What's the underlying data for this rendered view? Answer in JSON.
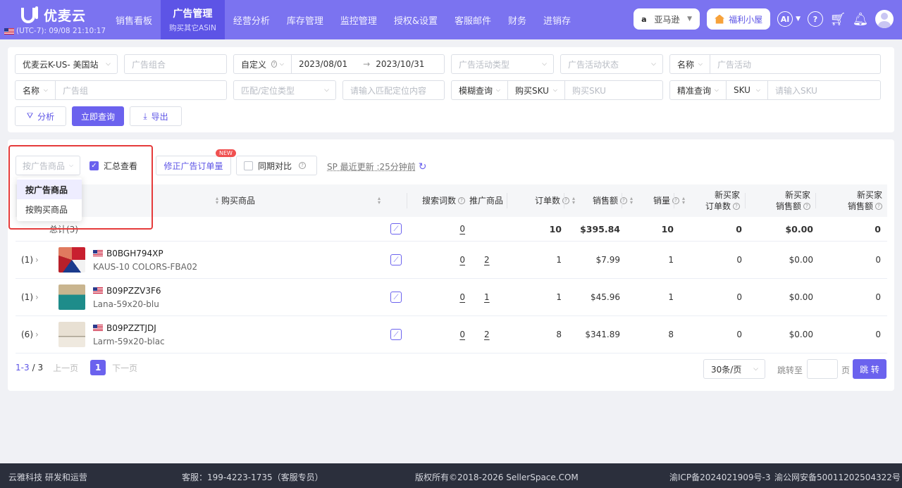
{
  "header": {
    "brand": "优麦云",
    "timezone": "(UTC-7): 09/08 21:10:17",
    "nav": [
      {
        "label": "销售看板",
        "sub": ""
      },
      {
        "label": "广告管理",
        "sub": "购买其它ASIN"
      },
      {
        "label": "经营分析",
        "sub": ""
      },
      {
        "label": "库存管理",
        "sub": ""
      },
      {
        "label": "监控管理",
        "sub": ""
      },
      {
        "label": "授权&设置",
        "sub": ""
      },
      {
        "label": "客服邮件",
        "sub": ""
      },
      {
        "label": "财务",
        "sub": ""
      },
      {
        "label": "进销存",
        "sub": ""
      }
    ],
    "marketplace": "亚马逊",
    "welfare": "福利小屋",
    "ai_label": "AI"
  },
  "filters": {
    "store": "优麦云K-US- 美国站",
    "ad_group_combo_ph": "广告组合",
    "date_mode": "自定义",
    "date_start": "2023/08/01",
    "date_arrow": "→",
    "date_end": "2023/10/31",
    "campaign_type_ph": "广告活动类型",
    "campaign_status_ph": "广告活动状态",
    "name_label_1": "名称",
    "campaign_ph": "广告活动",
    "name_label_2": "名称",
    "ad_group_ph": "广告组",
    "match_type_ph": "匹配/定位类型",
    "match_content_ph": "请输入匹配定位内容",
    "fuzzy_label": "模糊查询",
    "buy_sku_label": "购买SKU",
    "buy_sku_ph": "购买SKU",
    "exact_label": "精准查询",
    "sku_label": "SKU",
    "sku_ph": "请输入SKU",
    "analyze_btn": "分析",
    "query_btn": "立即查询",
    "export_btn": "导出"
  },
  "toolbar": {
    "group_by_ph": "按广告商品",
    "summary_label": "汇总查看",
    "fix_orders_label": "修正广告订单量",
    "new_tag": "NEW",
    "compare_label": "同期对比",
    "updated_label": "SP 最近更新 :25分钟前",
    "dropdown": [
      "按广告商品",
      "按购买商品"
    ]
  },
  "table": {
    "headers": {
      "buy_product": "购买商品",
      "search_terms": "搜索词数",
      "ad_product": "推广商品",
      "orders": "订单数",
      "sales": "销售额",
      "units": "销量",
      "nb_orders_1": "新买家",
      "nb_orders_2": "订单数",
      "nb_sales_1": "新买家",
      "nb_sales_2": "销售额",
      "nb_sales_b_1": "新买家",
      "nb_sales_b_2": "销售额"
    },
    "total": {
      "label": "总计(3)",
      "search_terms": "0",
      "orders": "10",
      "sales": "$395.84",
      "units": "10",
      "nb_orders": "0",
      "nb_sales": "$0.00",
      "nb_sales_b": "0"
    },
    "rows": [
      {
        "count": "(1)",
        "asin": "B0BGH794XP",
        "sku": "KAUS-10 COLORS-FBA02",
        "search_terms": "0",
        "ad_product": "2",
        "orders": "1",
        "sales": "$7.99",
        "units": "1",
        "nb_orders": "0",
        "nb_sales": "$0.00",
        "nb_sales_b": "0"
      },
      {
        "count": "(1)",
        "asin": "B09PZZV3F6",
        "sku": "Lana-59x20-blu",
        "search_terms": "0",
        "ad_product": "1",
        "orders": "1",
        "sales": "$45.96",
        "units": "1",
        "nb_orders": "0",
        "nb_sales": "$0.00",
        "nb_sales_b": "0"
      },
      {
        "count": "(6)",
        "asin": "B09PZZTJDJ",
        "sku": "Larm-59x20-blac",
        "search_terms": "0",
        "ad_product": "2",
        "orders": "8",
        "sales": "$341.89",
        "units": "8",
        "nb_orders": "0",
        "nb_sales": "$0.00",
        "nb_sales_b": "0"
      }
    ]
  },
  "pager": {
    "range": "1-3",
    "total": "/ 3",
    "prev": "上一页",
    "page": "1",
    "next": "下一页",
    "page_size": "30条/页",
    "jump_label": "跳转至",
    "page_unit": "页",
    "jump_btn": "跳 转"
  },
  "footer": {
    "company": "云雅科技 研发和运营",
    "service": "客服：199-4223-1735（客服专员）",
    "copyright": "版权所有©2018-2026 SellerSpace.COM",
    "icp": "渝ICP备2024021909号-3",
    "police": "渝公网安备50011202504322号"
  }
}
